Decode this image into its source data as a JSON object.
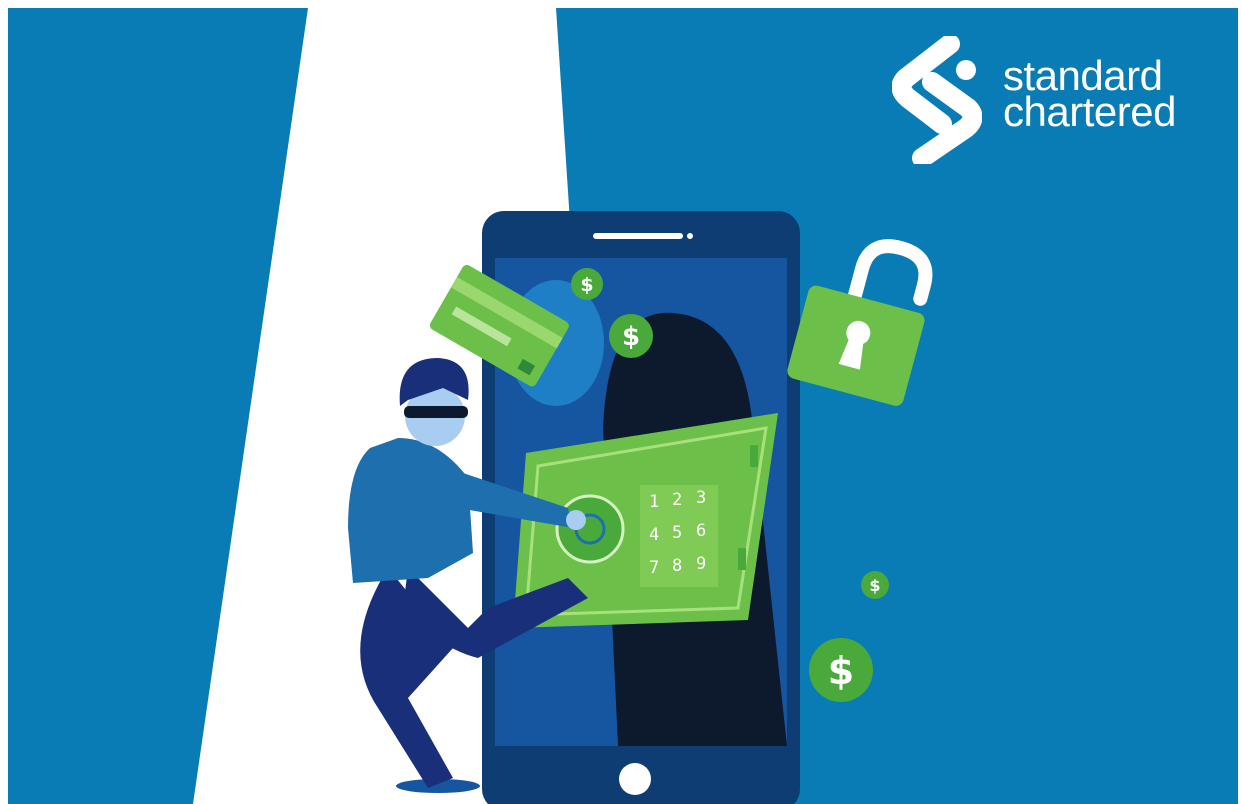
{
  "brand": {
    "line1": "standard",
    "line2": "chartered",
    "logo_icon": "standard-chartered-logo-icon"
  },
  "illustration": {
    "theme": "online banking fraud",
    "keypad_digits": [
      "1",
      "2",
      "3",
      "4",
      "5",
      "6",
      "7",
      "8",
      "9"
    ],
    "currency_symbol": "$",
    "icons": [
      "phone-icon",
      "thief-icon",
      "credit-card-icon",
      "padlock-icon",
      "vault-safe-icon",
      "dollar-coin-icon"
    ]
  },
  "colors": {
    "background": "#0a7cb5",
    "spotlight": "#ffffff",
    "phone_body": "#0d3d73",
    "phone_screen": "#0d1a2e",
    "accent_green": "#6cc04a",
    "dark_green": "#2e8a3a",
    "thief_shirt": "#1e6fae",
    "thief_pants": "#1a2f7a"
  }
}
